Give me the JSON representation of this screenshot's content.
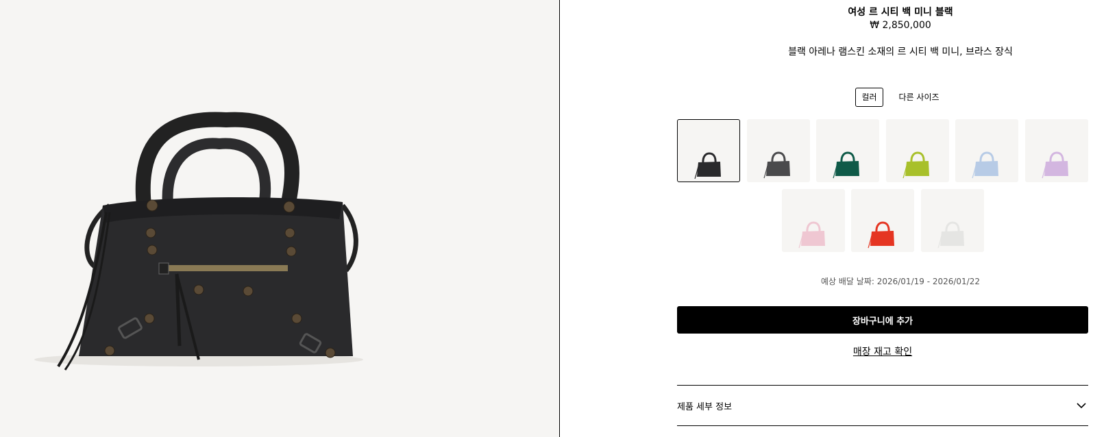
{
  "product": {
    "title": "여성 르 시티 백 미니 블랙",
    "price": "₩ 2,850,000",
    "description": "블랙 아레나 램스킨 소재의 르 시티 백 미니, 브라스 장식"
  },
  "variant_tabs": [
    {
      "label": "컬러",
      "active": true
    },
    {
      "label": "다른 사이즈",
      "active": false
    }
  ],
  "swatches": [
    {
      "name": "black",
      "color": "#2a2a2c",
      "selected": true
    },
    {
      "name": "dark-grey",
      "color": "#4a4a4c",
      "selected": false
    },
    {
      "name": "green",
      "color": "#0f5a48",
      "selected": false
    },
    {
      "name": "lime",
      "color": "#a8c02a",
      "selected": false
    },
    {
      "name": "light-blue",
      "color": "#b7cbe6",
      "selected": false
    },
    {
      "name": "lilac",
      "color": "#d3b6e0",
      "selected": false
    },
    {
      "name": "light-pink",
      "color": "#efc7d2",
      "selected": false
    },
    {
      "name": "red",
      "color": "#e53522",
      "selected": false
    },
    {
      "name": "white",
      "color": "#e5e5e3",
      "selected": false
    }
  ],
  "delivery": {
    "text": "예상 배달 날짜: 2026/01/19 - 2026/01/22"
  },
  "actions": {
    "add_to_cart": "장바구니에 추가",
    "check_stock": "매장 재고 확인"
  },
  "accordion": {
    "product_details": "제품 세부 정보"
  },
  "colors": {
    "background_image": "#f6f5f3",
    "bag": "#2a2a2c",
    "accent": "#000000"
  }
}
